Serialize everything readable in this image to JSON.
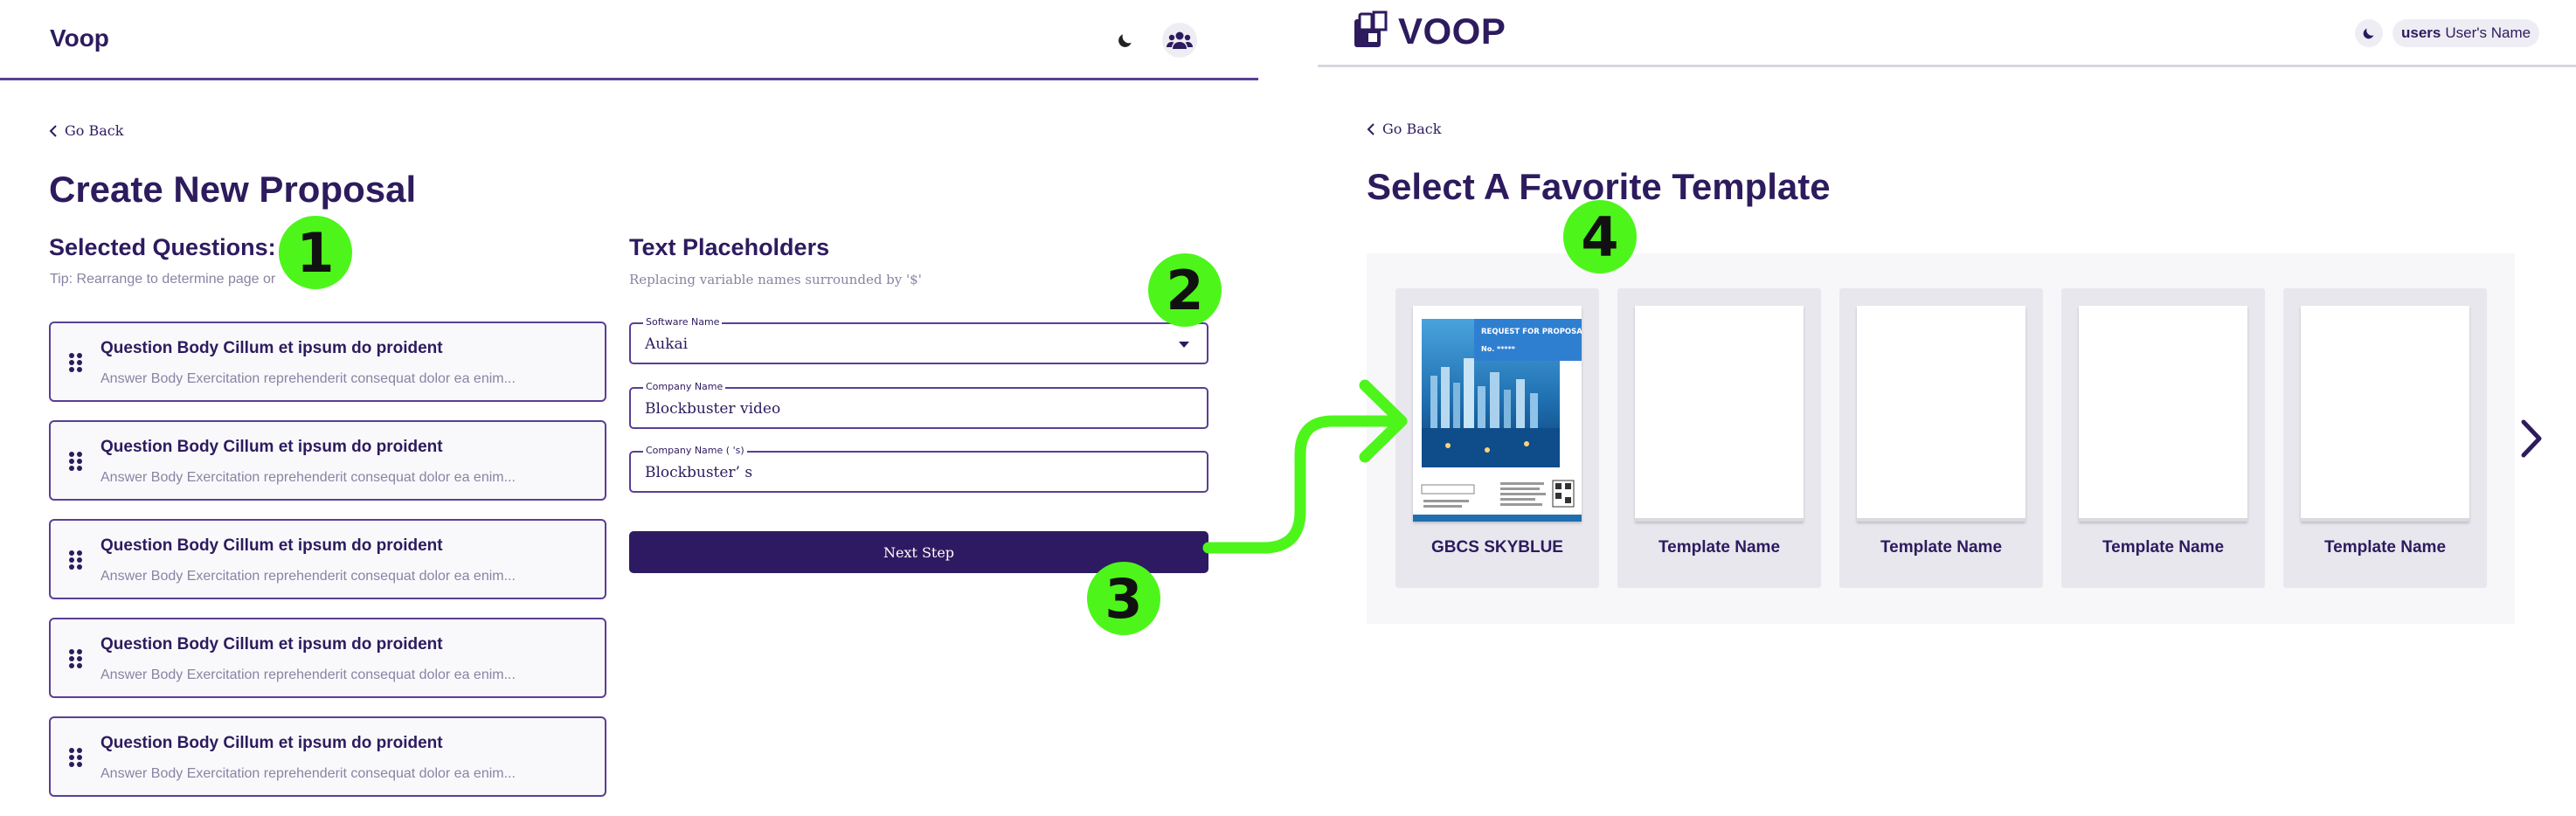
{
  "left": {
    "brand": "Voop",
    "go_back": "Go Back",
    "title": "Create New Proposal",
    "selected_questions": {
      "heading": "Selected Questions:",
      "tip": "Tip: Rearrange to determine page or",
      "items": [
        {
          "title": "Question Body Cillum et ipsum do proident",
          "body": "Answer Body Exercitation reprehenderit consequat dolor ea enim..."
        },
        {
          "title": "Question Body Cillum et ipsum do proident",
          "body": "Answer Body Exercitation reprehenderit consequat dolor ea enim..."
        },
        {
          "title": "Question Body Cillum et ipsum do proident",
          "body": "Answer Body Exercitation reprehenderit consequat dolor ea enim..."
        },
        {
          "title": "Question Body Cillum et ipsum do proident",
          "body": "Answer Body Exercitation reprehenderit consequat dolor ea enim..."
        },
        {
          "title": "Question Body Cillum et ipsum do proident",
          "body": "Answer Body Exercitation reprehenderit consequat dolor ea enim..."
        }
      ]
    },
    "placeholders": {
      "heading": "Text Placeholders",
      "subtitle": "Replacing variable names surrounded by '$'",
      "fields": [
        {
          "label": "Software Name",
          "value": "Aukai"
        },
        {
          "label": "Company Name",
          "value": "Blockbuster video"
        },
        {
          "label": "Company Name ( 's)",
          "value": "Blockbuster’ s"
        }
      ]
    },
    "next_step": "Next Step"
  },
  "right": {
    "brand": "VOOP",
    "user_bold": "users",
    "user_name": "User's Name",
    "go_back": "Go Back",
    "title": "Select A Favorite Template",
    "thumb_text": {
      "title": "REQUEST FOR PROPOSAL (RFP)",
      "number": "No. *****"
    },
    "templates": [
      {
        "name": "GBCS SKYBLUE"
      },
      {
        "name": "Template Name"
      },
      {
        "name": "Template Name"
      },
      {
        "name": "Template Name"
      },
      {
        "name": "Template Name"
      }
    ]
  },
  "annotations": [
    "1",
    "2",
    "3",
    "4"
  ],
  "colors": {
    "primary": "#2e1a62",
    "text": "#2d1b5e",
    "muted": "#8a83a3",
    "annotation": "#4ef51b",
    "card_bg": "#e8e7ee"
  }
}
